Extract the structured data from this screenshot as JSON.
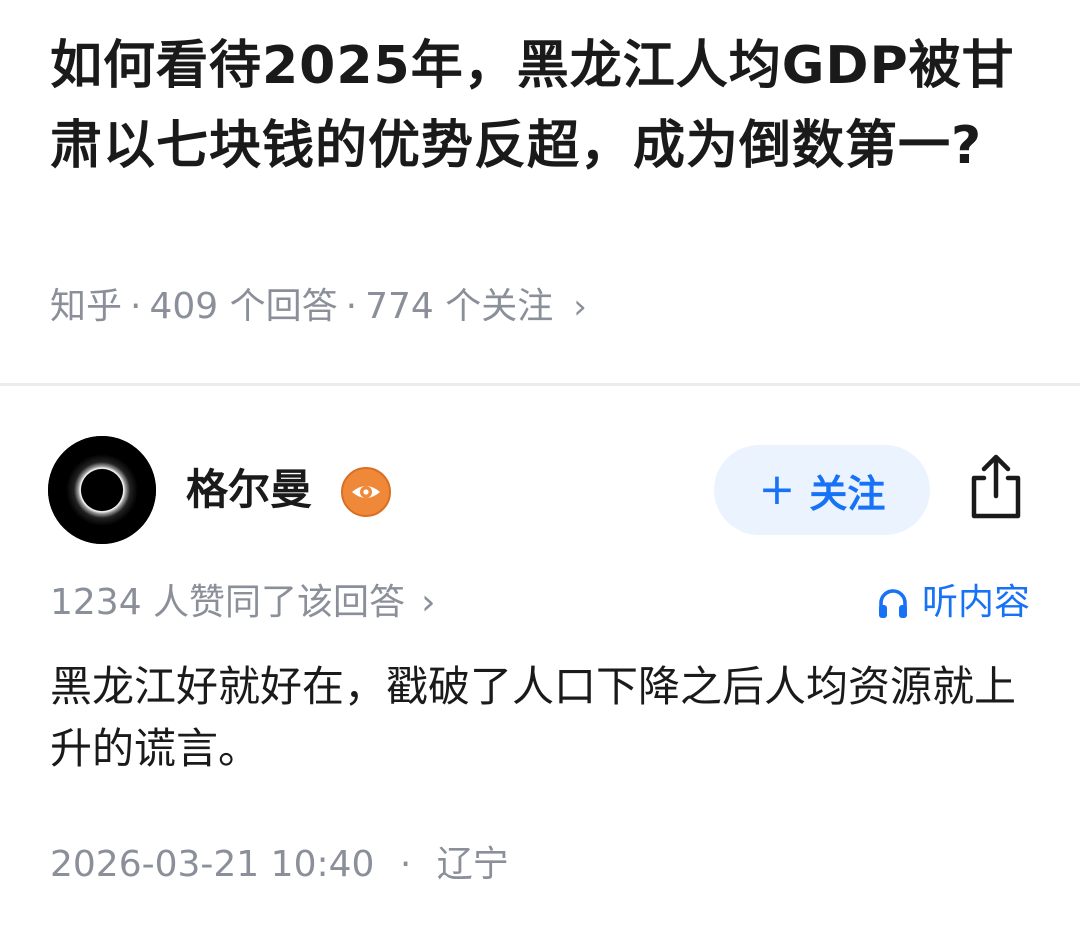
{
  "question": {
    "title": "如何看待2025年，黑龙江人均GDP被甘肃以七块钱的优势反超，成为倒数第一?",
    "source": "知乎",
    "answer_count": "409 个回答",
    "follow_count": "774 个关注",
    "separator": "·",
    "chevron": "›"
  },
  "author": {
    "name": "格尔曼",
    "avatar_icon": "eclipse-avatar",
    "badge_icon": "eye-badge-icon",
    "follow_label": "关注",
    "follow_plus": "+",
    "share_icon": "share-icon"
  },
  "answer": {
    "upvote_text": "1234 人赞同了该回答",
    "chevron": "›",
    "listen_label": "听内容",
    "listen_icon": "headphones-icon",
    "content": "黑龙江好就好在，戳破了人口下降之后人均资源就上升的谎言。",
    "datetime": "2026-03-21 10:40",
    "separator": "·",
    "location": "辽宁"
  },
  "colors": {
    "accent": "#1772f6",
    "follow_bg": "#ebf3ff",
    "meta_gray": "#8a8f99",
    "badge_orange": "#f0883a",
    "text": "#1a1a1a"
  }
}
